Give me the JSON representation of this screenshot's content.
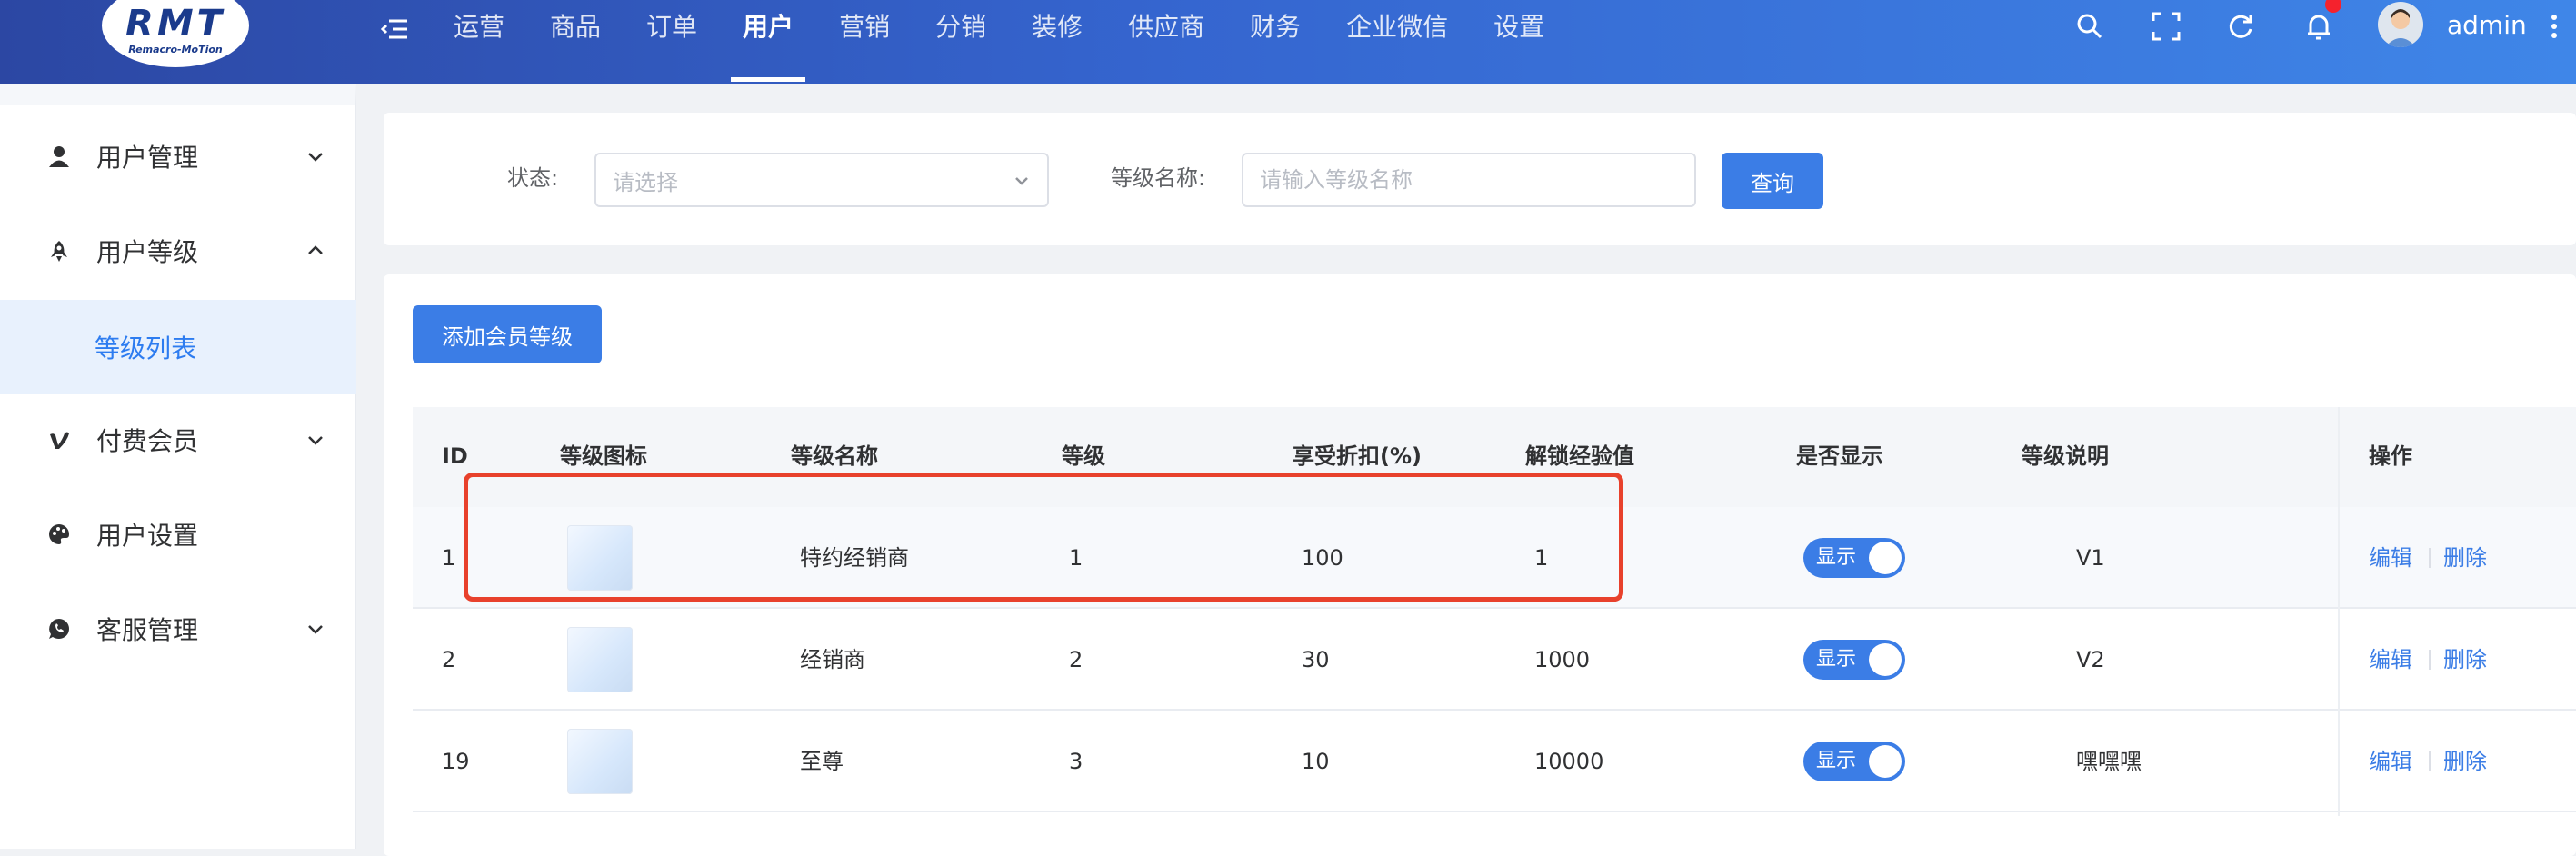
{
  "header": {
    "logo_text": "RMT",
    "logo_subtext": "Remacro-MoTion",
    "nav": [
      "运营",
      "商品",
      "订单",
      "用户",
      "营销",
      "分销",
      "装修",
      "供应商",
      "财务",
      "企业微信",
      "设置"
    ],
    "active_nav": "用户",
    "username": "admin"
  },
  "sidebar": {
    "items": [
      {
        "label": "用户管理",
        "icon": "user-icon",
        "expanded": false
      },
      {
        "label": "用户等级",
        "icon": "rocket-icon",
        "expanded": true
      },
      {
        "label": "等级列表",
        "sub": true,
        "active": true
      },
      {
        "label": "付费会员",
        "icon": "vip-icon",
        "expanded": false
      },
      {
        "label": "用户设置",
        "icon": "palette-icon"
      },
      {
        "label": "客服管理",
        "icon": "chat-icon",
        "expanded": false
      }
    ]
  },
  "filter": {
    "status_label": "状态:",
    "status_placeholder": "请选择",
    "name_label": "等级名称:",
    "name_placeholder": "请输入等级名称",
    "query_button": "查询"
  },
  "toolbar": {
    "add_button": "添加会员等级"
  },
  "table": {
    "columns": [
      "ID",
      "等级图标",
      "等级名称",
      "等级",
      "享受折扣(%)",
      "解锁经验值",
      "是否显示",
      "等级说明",
      "操作"
    ],
    "rows": [
      {
        "id": "1",
        "name": "特约经销商",
        "level": "1",
        "discount": "100",
        "exp": "1",
        "show": "显示",
        "desc": "V1"
      },
      {
        "id": "2",
        "name": "经销商",
        "level": "2",
        "discount": "30",
        "exp": "1000",
        "show": "显示",
        "desc": "V2"
      },
      {
        "id": "19",
        "name": "至尊",
        "level": "3",
        "discount": "10",
        "exp": "10000",
        "show": "显示",
        "desc": "嘿嘿嘿"
      }
    ],
    "edit_label": "编辑",
    "delete_label": "删除"
  },
  "colors": {
    "primary": "#3b7de6",
    "highlight": "#e8412c",
    "header_from": "#2c47a3",
    "header_to": "#3f86e8"
  }
}
